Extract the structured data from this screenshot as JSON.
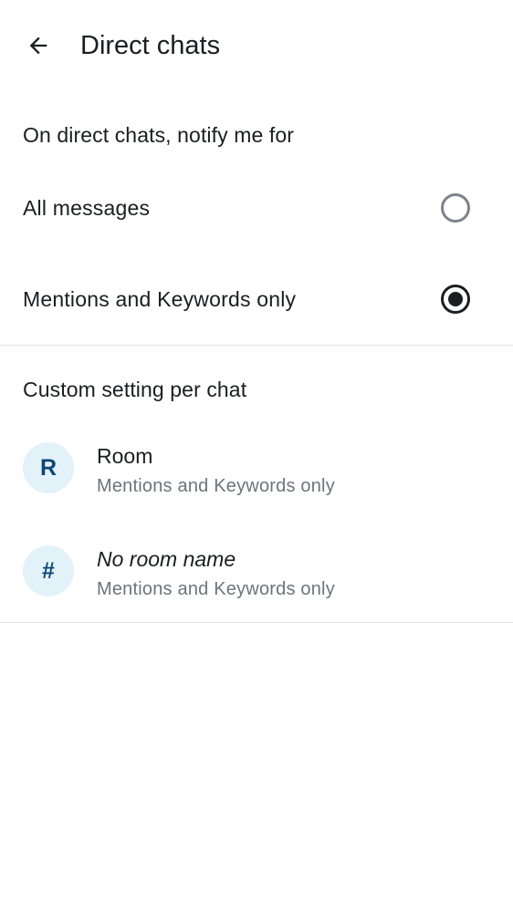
{
  "header": {
    "title": "Direct chats",
    "back_icon": "arrow-left-icon"
  },
  "notify_section": {
    "title": "On direct chats, notify me for",
    "options": [
      {
        "label": "All messages",
        "selected": false
      },
      {
        "label": "Mentions and Keywords only",
        "selected": true
      }
    ]
  },
  "custom_section": {
    "title": "Custom setting per chat",
    "chats": [
      {
        "avatar_text": "R",
        "name": "Room",
        "italic": false,
        "setting": "Mentions and Keywords only"
      },
      {
        "avatar_text": "#",
        "name": "No room name",
        "italic": true,
        "setting": "Mentions and Keywords only"
      }
    ]
  },
  "colors": {
    "avatar_bg": "#e3f2f8",
    "avatar_fg": "#0b4677",
    "divider": "#e1e3e6",
    "secondary_text": "#6e737c"
  }
}
